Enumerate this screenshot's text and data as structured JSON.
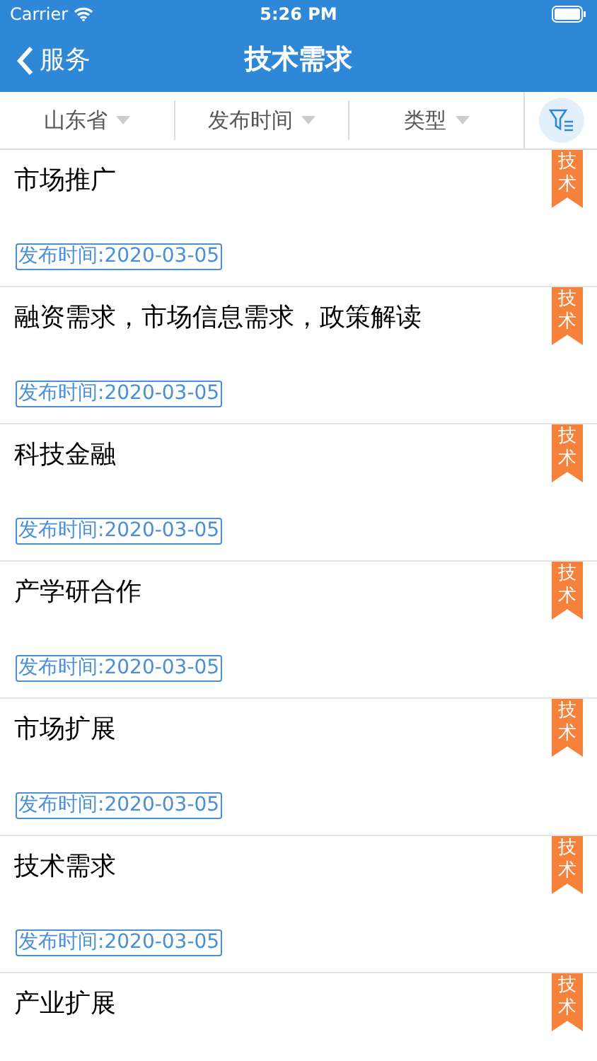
{
  "status_bar": {
    "carrier": "Carrier",
    "time": "5:26 PM"
  },
  "nav": {
    "back": "服务",
    "title": "技术需求"
  },
  "filters": [
    {
      "label": "山东省"
    },
    {
      "label": "发布时间"
    },
    {
      "label": "类型"
    }
  ],
  "items": [
    {
      "title": "市场推广",
      "tag": "技术",
      "date": "发布时间:2020-03-05"
    },
    {
      "title": "融资需求，市场信息需求，政策解读",
      "tag": "技术",
      "date": "发布时间:2020-03-05"
    },
    {
      "title": "科技金融",
      "tag": "技术",
      "date": "发布时间:2020-03-05"
    },
    {
      "title": "产学研合作",
      "tag": "技术",
      "date": "发布时间:2020-03-05"
    },
    {
      "title": "市场扩展",
      "tag": "技术",
      "date": "发布时间:2020-03-05"
    },
    {
      "title": "技术需求",
      "tag": "技术",
      "date": "发布时间:2020-03-05"
    },
    {
      "title": "产业扩展",
      "tag": "技术"
    }
  ]
}
